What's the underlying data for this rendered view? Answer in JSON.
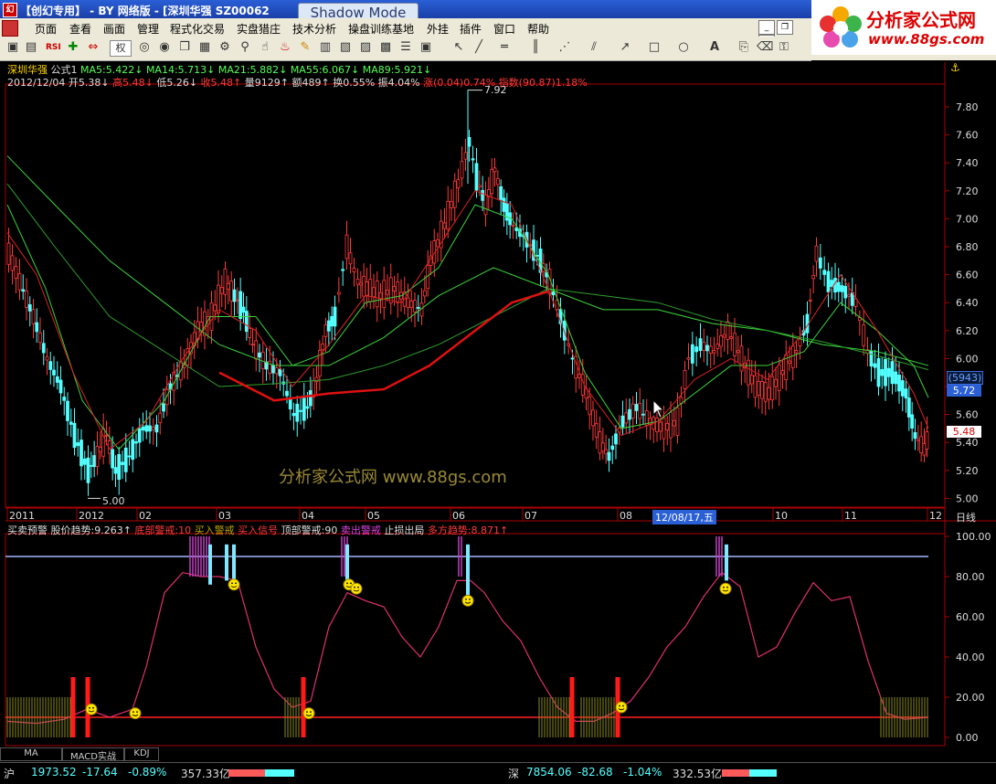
{
  "window": {
    "title": "【创幻专用】 - BY 网络版 - [深圳华强 SZ00062",
    "shadow_mode": "Shadow Mode"
  },
  "logo": {
    "brand": "分析家公式网",
    "url": "www.88gs.com"
  },
  "menu": [
    "页面",
    "查看",
    "画面",
    "管理",
    "程式化交易",
    "实盘猎庄",
    "技术分析",
    "操盘训练基地",
    "外挂",
    "插件",
    "窗口",
    "帮助"
  ],
  "toolbar": {
    "rights_label": "权"
  },
  "main": {
    "stock_name": "深圳华强",
    "formula": "公式1",
    "ma5": "MA5:5.422↓",
    "ma14": "MA14:5.713↓",
    "ma21": "MA21:5.882↓",
    "ma55": "MA55:6.067↓",
    "ma89": "MA89:5.921↓",
    "date": "2012/12/04",
    "open": "开5.38↓",
    "high": "高5.48↓",
    "low": "低5.26↓",
    "close": "收5.48↑",
    "volume": "量9129↑",
    "amount": "额489↑",
    "turnover": "换0.55%",
    "amplitude": "振4.04%",
    "change": "涨(0.04)0.74%",
    "index": "指数(90.87)1.18%",
    "max_label": "7.92",
    "min_label": "5.00",
    "price_box_1": "(5943)",
    "price_box_2": "5.72",
    "price_box_3": "5.48",
    "date_cursor": "12/08/17,五",
    "period": "日线",
    "watermark": "分析家公式网 www.88gs.com"
  },
  "price_axis": [
    "7.80",
    "7.60",
    "7.40",
    "7.20",
    "7.00",
    "6.80",
    "6.60",
    "6.40",
    "6.20",
    "6.00",
    "5.80",
    "5.60",
    "5.40",
    "5.20",
    "5.00"
  ],
  "time_axis": [
    "2011",
    "2012",
    "02",
    "03",
    "04",
    "05",
    "06",
    "07",
    "08",
    "10",
    "11",
    "12"
  ],
  "sub": {
    "title": "买卖预警",
    "trend": "股价趋势:9.263↑",
    "bottom_alert": "底部警戒:10",
    "buy_alert": "买入警戒",
    "buy_signal": "买入信号",
    "top_alert": "顶部警戒:90",
    "sell_alert": "卖出警戒",
    "stop_loss": "止损出局",
    "bull_trend": "多方趋势:8.871↑",
    "axis": [
      "100.00",
      "80.00",
      "60.00",
      "40.00",
      "20.00",
      "0.00"
    ]
  },
  "tabs": [
    "MA",
    "MACD实战",
    "KDJ"
  ],
  "status": {
    "sh_label": "沪",
    "sh_index": "1973.52",
    "sh_change": "-17.64",
    "sh_pct": "-0.89%",
    "sh_amount": "357.33亿",
    "sz_label": "深",
    "sz_index": "7854.06",
    "sz_change": "-82.68",
    "sz_pct": "-1.04%",
    "sz_amount": "332.53亿"
  },
  "colors": {
    "up": "#ff3b3b",
    "down": "#54ffff",
    "ma_green": "#3bd43b",
    "ma_red": "#d22",
    "alert_magenta": "#c040c0"
  }
}
